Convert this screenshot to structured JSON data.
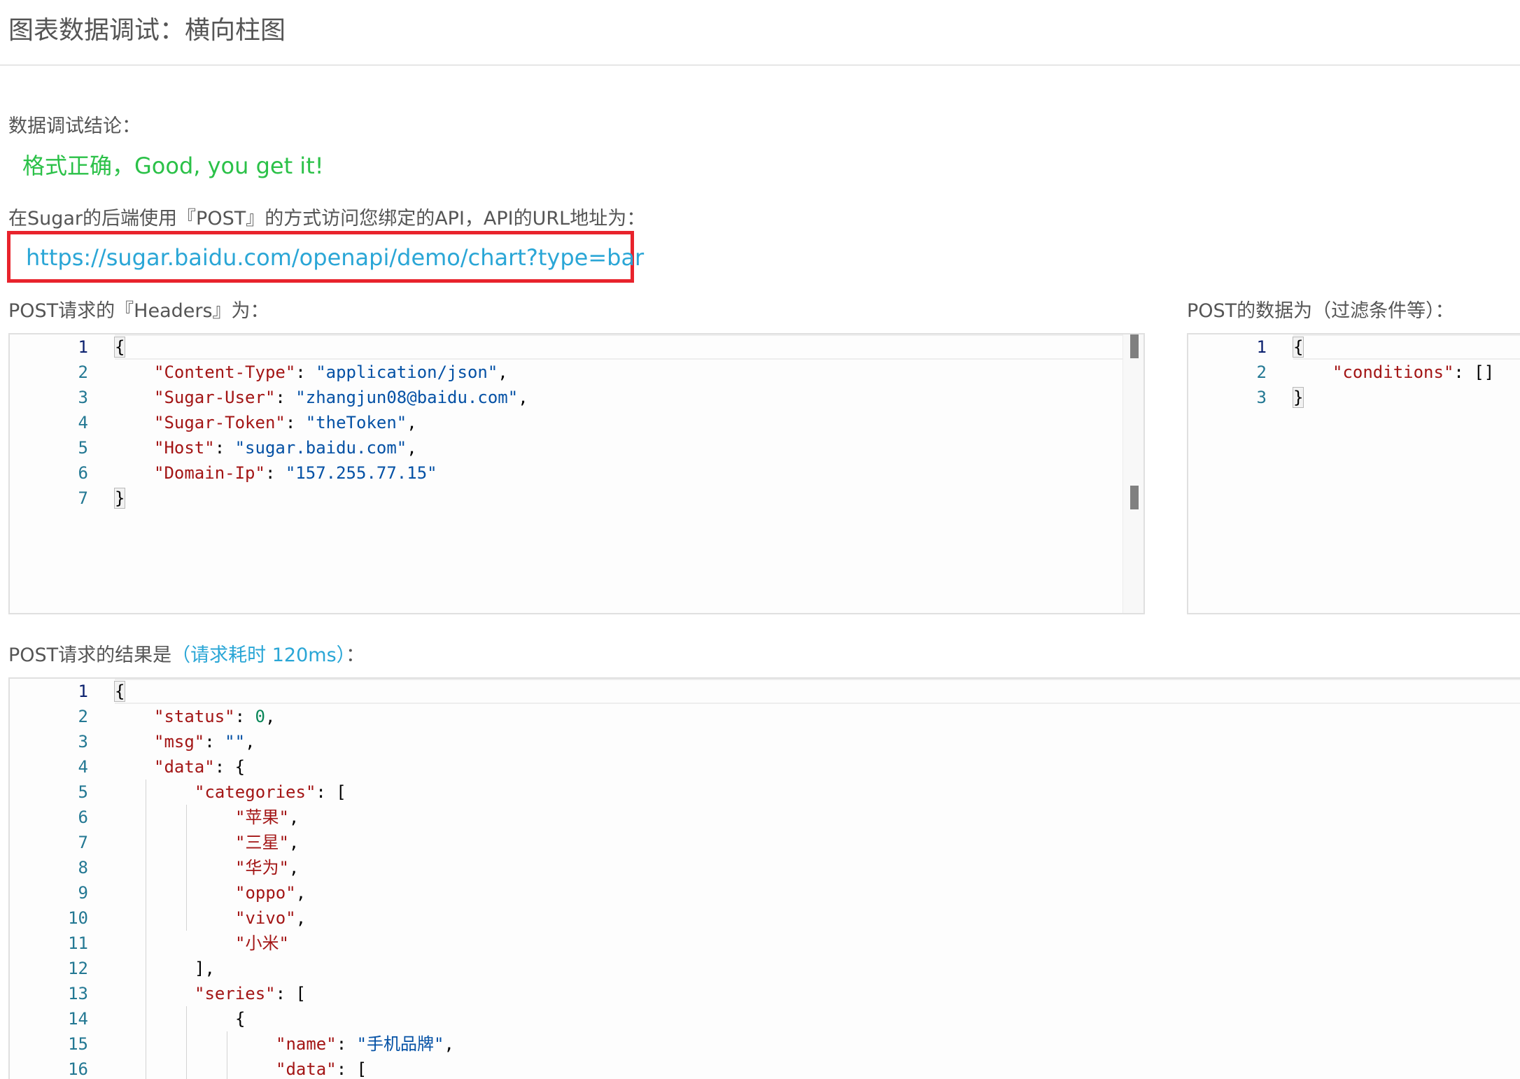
{
  "page": {
    "title": "图表数据调试：横向柱图"
  },
  "result": {
    "label": "数据调试结论：",
    "message": "格式正确，Good, you get it!"
  },
  "api": {
    "intro": "在Sugar的后端使用『POST』的方式访问您绑定的API，API的URL地址为：",
    "url": "https://sugar.baidu.com/openapi/demo/chart?type=bar"
  },
  "headers_section": {
    "label": "POST请求的『Headers』为："
  },
  "post_data_section": {
    "label": "POST的数据为（过滤条件等）："
  },
  "response_section": {
    "label": "POST请求的结果是",
    "cost": "（请求耗时 120ms）",
    "suffix": "："
  },
  "headers_editor": {
    "line_numbers": [
      "1",
      "2",
      "3",
      "4",
      "5",
      "6",
      "7"
    ],
    "open_brace": "{",
    "close_brace": "}",
    "entries": [
      {
        "key": "\"Content-Type\"",
        "value": "\"application/json\"",
        "tail": ","
      },
      {
        "key": "\"Sugar-User\"",
        "value": "\"zhangjun08@baidu.com\"",
        "tail": ","
      },
      {
        "key": "\"Sugar-Token\"",
        "value": "\"theToken\"",
        "tail": ","
      },
      {
        "key": "\"Host\"",
        "value": "\"sugar.baidu.com\"",
        "tail": ","
      },
      {
        "key": "\"Domain-Ip\"",
        "value": "\"157.255.77.15\"",
        "tail": ""
      }
    ]
  },
  "post_data_editor": {
    "line_numbers": [
      "1",
      "2",
      "3"
    ],
    "open_brace": "{",
    "close_brace": "}",
    "key": "\"conditions\"",
    "value": "[]"
  },
  "response_editor": {
    "line_numbers": [
      "1",
      "2",
      "3",
      "4",
      "5",
      "6",
      "7",
      "8",
      "9",
      "10",
      "11",
      "12",
      "13",
      "14",
      "15",
      "16"
    ],
    "open_brace": "{",
    "status_key": "\"status\"",
    "status_value": "0",
    "msg_key": "\"msg\"",
    "msg_value": "\"\"",
    "data_key": "\"data\"",
    "categories_key": "\"categories\"",
    "categories": [
      "\"苹果\"",
      "\"三星\"",
      "\"华为\"",
      "\"oppo\"",
      "\"vivo\"",
      "\"小米\""
    ],
    "categories_close": "],",
    "series_key": "\"series\"",
    "series_open_brace": "{",
    "name_key": "\"name\"",
    "name_value": "\"手机品牌\"",
    "data_inner_key": "\"data\""
  }
}
